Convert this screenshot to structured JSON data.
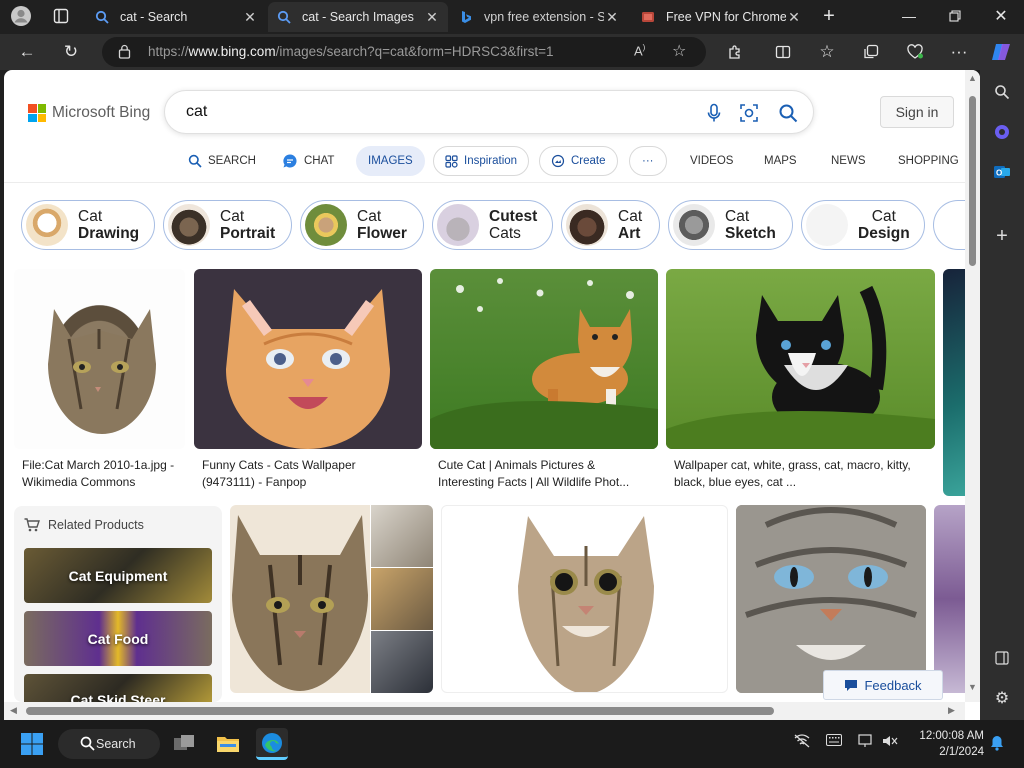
{
  "tabs": [
    {
      "title": "cat - Search"
    },
    {
      "title": "cat - Search Images"
    },
    {
      "title": "vpn free extension - Search"
    },
    {
      "title": "Free VPN for Chrome"
    }
  ],
  "address_bar": {
    "url_prefix": "https://",
    "url_host": "www.bing.com",
    "url_path": "/images/search?q=cat&form=HDRSC3&first=1"
  },
  "bing": {
    "logo": "Microsoft Bing",
    "query": "cat",
    "signin": "Sign in",
    "nav": {
      "search": "SEARCH",
      "chat": "CHAT",
      "images": "IMAGES",
      "inspiration": "Inspiration",
      "create": "Create",
      "more": "···",
      "videos": "VIDEOS",
      "maps": "MAPS",
      "news": "NEWS",
      "shopping": "SHOPPING"
    }
  },
  "related_chips": [
    {
      "top": "Cat",
      "bottom": "Drawing",
      "bold": "bottom"
    },
    {
      "top": "Cat",
      "bottom": "Portrait",
      "bold": "bottom"
    },
    {
      "top": "Cat",
      "bottom": "Flower",
      "bold": "bottom"
    },
    {
      "top": "Cutest",
      "bottom": "Cats",
      "bold": "top"
    },
    {
      "top": "Cat",
      "bottom": "Art",
      "bold": "bottom"
    },
    {
      "top": "Cat",
      "bottom": "Sketch",
      "bold": "bottom"
    },
    {
      "top": "Cat",
      "bottom": "Design",
      "bold": "bottom"
    }
  ],
  "results_row1": [
    {
      "line1": "File:Cat March 2010-1a.jpg -",
      "line2": "Wikimedia Commons"
    },
    {
      "line1": "Funny Cats - Cats Wallpaper",
      "line2": "(9473111) - Fanpop"
    },
    {
      "line1": "Cute Cat | Animals Pictures &",
      "line2": "Interesting Facts | All Wildlife Phot..."
    },
    {
      "line1": "Wallpaper cat, white, grass, cat, macro, kitty,",
      "line2": "black, blue eyes, cat ..."
    }
  ],
  "related_products": {
    "heading": "Related Products",
    "items": [
      "Cat Equipment",
      "Cat Food",
      "Cat Skid Steer"
    ]
  },
  "feedback": "Feedback",
  "taskbar": {
    "search": "Search",
    "time": "12:00:08 AM",
    "date": "2/1/2024"
  }
}
